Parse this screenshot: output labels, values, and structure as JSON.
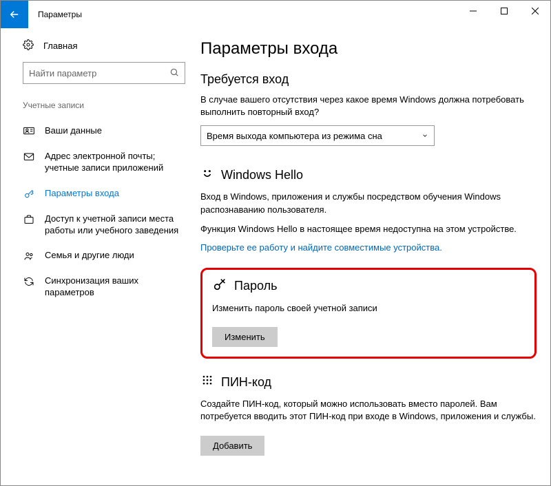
{
  "window": {
    "title": "Параметры"
  },
  "sidebar": {
    "home": "Главная",
    "search_placeholder": "Найти параметр",
    "category": "Учетные записи",
    "items": [
      {
        "label": "Ваши данные"
      },
      {
        "label": "Адрес электронной почты; учетные записи приложений"
      },
      {
        "label": "Параметры входа"
      },
      {
        "label": "Доступ к учетной записи места работы или учебного заведения"
      },
      {
        "label": "Семья и другие люди"
      },
      {
        "label": "Синхронизация ваших параметров"
      }
    ]
  },
  "main": {
    "page_title": "Параметры входа",
    "require_signin": {
      "title": "Требуется вход",
      "desc": "В случае вашего отсутствия через какое время Windows должна потребовать выполнить повторный вход?",
      "selected": "Время выхода компьютера из режима сна"
    },
    "hello": {
      "title": "Windows Hello",
      "desc1": "Вход в Windows, приложения и службы посредством обучения Windows распознаванию пользователя.",
      "desc2": "Функция Windows Hello в настоящее время недоступна на этом устройстве.",
      "link": "Проверьте ее работу и найдите совместимые устройства."
    },
    "password": {
      "title": "Пароль",
      "desc": "Изменить пароль своей учетной записи",
      "button": "Изменить"
    },
    "pin": {
      "title": "ПИН-код",
      "desc": "Создайте ПИН-код, который можно использовать вместо паролей. Вам потребуется вводить этот ПИН-код при входе в Windows, приложения и службы.",
      "button": "Добавить"
    }
  }
}
